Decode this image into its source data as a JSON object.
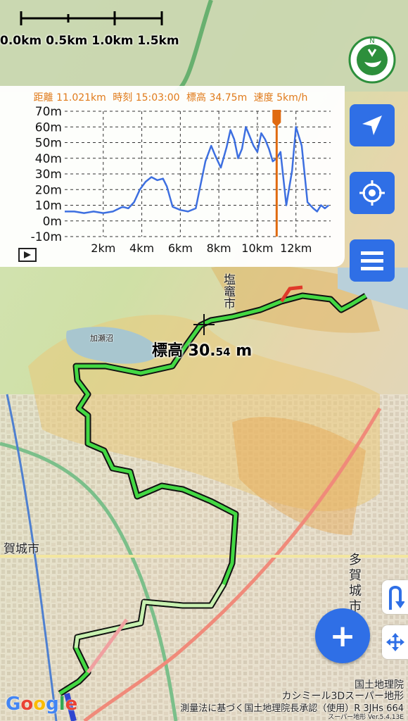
{
  "scale": {
    "labels": [
      "0.0km",
      "0.5km",
      "1.0km",
      "1.5km"
    ]
  },
  "readout": {
    "distance": "距離 11.021km",
    "time": "時刻 15:03:00",
    "elevation": "標高 34.75m",
    "speed": "速度 5km/h"
  },
  "chart_data": {
    "type": "line",
    "title": "",
    "xlabel": "",
    "ylabel": "",
    "x_ticks": [
      "2km",
      "4km",
      "6km",
      "8km",
      "10km",
      "12km"
    ],
    "y_ticks": [
      "70m",
      "60m",
      "50m",
      "40m",
      "30m",
      "20m",
      "10m",
      "0m",
      "-10m"
    ],
    "xlim": [
      0,
      13.8
    ],
    "ylim": [
      -10,
      70
    ],
    "grid": true,
    "cursor_x": 11.0,
    "series": [
      {
        "color": "#3d6fe0",
        "x": [
          0,
          0.5,
          1.0,
          1.5,
          2.0,
          2.5,
          3.0,
          3.3,
          3.6,
          3.9,
          4.2,
          4.5,
          4.8,
          5.1,
          5.3,
          5.6,
          6.0,
          6.4,
          6.8,
          7.0,
          7.3,
          7.6,
          7.8,
          8.1,
          8.4,
          8.6,
          8.8,
          9.0,
          9.2,
          9.4,
          9.6,
          9.8,
          10.0,
          10.2,
          10.4,
          10.6,
          10.8,
          11.0,
          11.2,
          11.5,
          11.8,
          12.0,
          12.3,
          12.6,
          12.9,
          13.1,
          13.3,
          13.5,
          13.7
        ],
        "y": [
          6,
          6,
          5,
          6,
          5,
          6,
          9,
          8,
          12,
          20,
          25,
          28,
          26,
          27,
          22,
          9,
          7,
          6,
          8,
          20,
          38,
          48,
          42,
          34,
          47,
          58,
          52,
          40,
          46,
          60,
          54,
          48,
          44,
          56,
          52,
          46,
          38,
          40,
          44,
          10,
          32,
          60,
          48,
          12,
          8,
          6,
          10,
          8,
          10
        ]
      }
    ]
  },
  "map": {
    "elevation_label_main": "標高 30.",
    "elevation_label_small": "54",
    "elevation_label_unit": "m",
    "city_label_left": "賀城市",
    "city_label_right": "多\n賀\n城\n市",
    "shiogama_label": "塩竈市",
    "pond_label": "加瀬沼"
  },
  "credits": {
    "gsi": "国土地理院",
    "kashmir": "カシミール3Dスーパー地形",
    "survey": "測量法に基づく国土地理院長承認（使用）R 3JHs 664",
    "version": "スーパー地形 Ver.5.4.13E"
  },
  "google": {
    "letters": [
      "G",
      "o",
      "o",
      "g",
      "l",
      "e"
    ],
    "colors": [
      "#4285F4",
      "#EA4335",
      "#FBBC05",
      "#4285F4",
      "#34A853",
      "#EA4335"
    ]
  },
  "buttons": {
    "play_icon": "play-icon",
    "navigate_icon": "navigation-arrow-icon",
    "locate_icon": "crosshair-target-icon",
    "menu_icon": "hamburger-menu-icon",
    "uturn_icon": "u-turn-icon",
    "move_icon": "four-way-arrow-icon",
    "add_icon": "plus-icon",
    "add_label": "+"
  },
  "colors": {
    "accent": "#2f6fe6",
    "readout": "#e07a1a",
    "profile_line": "#3d6fe0",
    "cursor": "#e06a10",
    "track": "#43d843",
    "track_border": "#111111"
  }
}
